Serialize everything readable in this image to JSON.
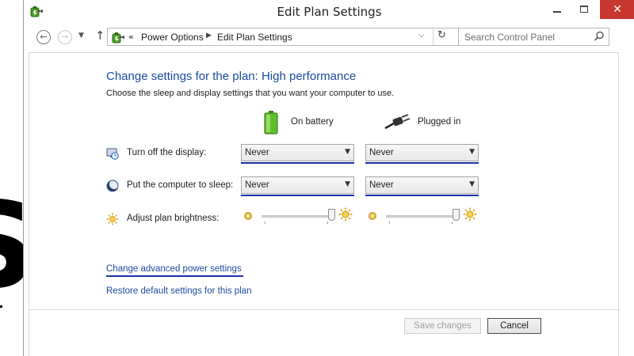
{
  "window": {
    "title": "Edit Plan Settings",
    "close_glyph": "✕"
  },
  "nav": {
    "back_glyph": "←",
    "forward_glyph": "→",
    "recent_glyph": "▼",
    "up_glyph": "↑",
    "overflow_glyph": "«",
    "breadcrumb": [
      "Power Options",
      "Edit Plan Settings"
    ],
    "breadcrumb_separator": "▶",
    "dropdown_glyph": "⌵",
    "refresh_glyph": "↻",
    "search_placeholder": "Search Control Panel"
  },
  "main": {
    "heading": "Change settings for the plan: High performance",
    "subheading": "Choose the sleep and display settings that you want your computer to use.",
    "columns": {
      "battery": "On battery",
      "plugged": "Plugged in"
    },
    "rows": {
      "display": {
        "label": "Turn off the display:",
        "battery": "Never",
        "plugged": "Never"
      },
      "sleep": {
        "label": "Put the computer to sleep:",
        "battery": "Never",
        "plugged": "Never"
      },
      "brightness": {
        "label": "Adjust plan brightness:",
        "battery_level": 1.0,
        "plugged_level": 1.0
      }
    },
    "combo_arrow": "▼",
    "links": {
      "advanced": "Change advanced power settings",
      "restore": "Restore default settings for this plan"
    }
  },
  "footer": {
    "save_label": "Save changes",
    "save_enabled": false,
    "cancel_label": "Cancel"
  },
  "colors": {
    "heading": "#1c4a9f",
    "link": "#1c4a9f",
    "focus_underline": "#1c2fa3",
    "close_button": "#c7372f"
  },
  "icons": {
    "app": "power-options-icon",
    "display": "clock-monitor-icon",
    "sleep": "moon-icon",
    "brightness": "sun-icon",
    "battery": "battery-icon",
    "plugged": "power-plug-icon"
  }
}
